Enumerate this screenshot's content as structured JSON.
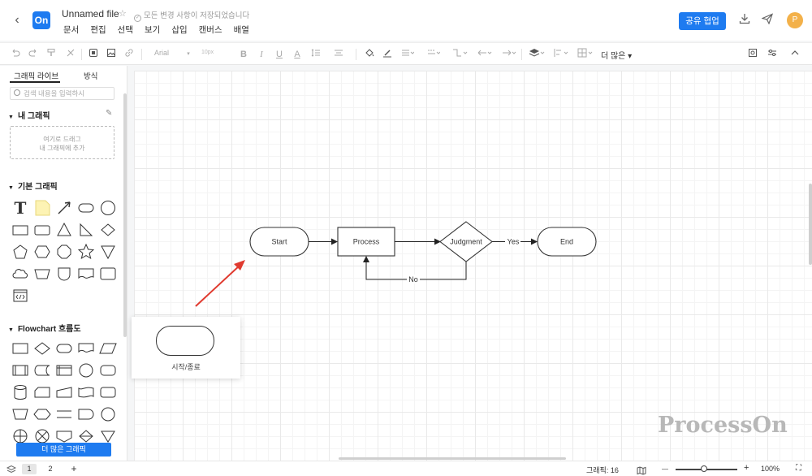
{
  "header": {
    "back": "‹",
    "logo": "On",
    "title": "Unnamed file",
    "star": "☆",
    "saved_check": "✓",
    "saved_status": "모든 변경 사항이 저장되었습니다",
    "menu": [
      "문서",
      "편집",
      "선택",
      "보기",
      "삽입",
      "캔버스",
      "배열"
    ],
    "share_label": "공유 협업",
    "avatar": "P",
    "icons": [
      "download-icon",
      "send-icon"
    ]
  },
  "toolbar": {
    "font": "Arial",
    "font_size": "10px",
    "more_label": "더 많은",
    "icons": [
      "undo-icon",
      "redo-icon",
      "format-painter-icon",
      "clear-format-icon",
      "select-icon",
      "image-icon",
      "link-icon",
      "bold-icon",
      "italic-icon",
      "underline-icon",
      "font-color-icon",
      "align-icon",
      "fill-icon",
      "line-color-icon",
      "line-style-icon",
      "connector-icon",
      "arrow-start-icon",
      "arrow-end-icon",
      "layer-icon",
      "align-distribute-icon",
      "grid-icon",
      "panel-icon",
      "settings-icon",
      "collapse-icon"
    ]
  },
  "sidebar": {
    "tab_graphics": "그래픽 라이브",
    "tab_style": "방식",
    "search_placeholder": "검색 내용을 입력하시",
    "my_graphics": "내 그래픽",
    "drop_zone_line1": "여기로 드래그",
    "drop_zone_line2": "내 그래픽에 추가",
    "basic_graphics": "기본 그래픽",
    "flowchart": "Flowchart 흐름도",
    "more_shapes": "더 많은 그래픽",
    "text_glyph": "T"
  },
  "flowchart": {
    "start": "Start",
    "process": "Process",
    "judgment": "Judgment",
    "end": "End",
    "yes": "Yes",
    "no": "No"
  },
  "popup": {
    "label": "시작/종료"
  },
  "watermark": "ProcessOn",
  "status": {
    "page1": "1",
    "page2": "2",
    "add": "+",
    "shape_count": "그래픽: 16",
    "zoom_minus": "—",
    "zoom_plus": "+",
    "zoom": "100%",
    "fullscreen": "⛶"
  },
  "colors": {
    "accent": "#1e7bf0",
    "avatar": "#f3b14a",
    "arrow_annotation": "#e03a2f"
  }
}
